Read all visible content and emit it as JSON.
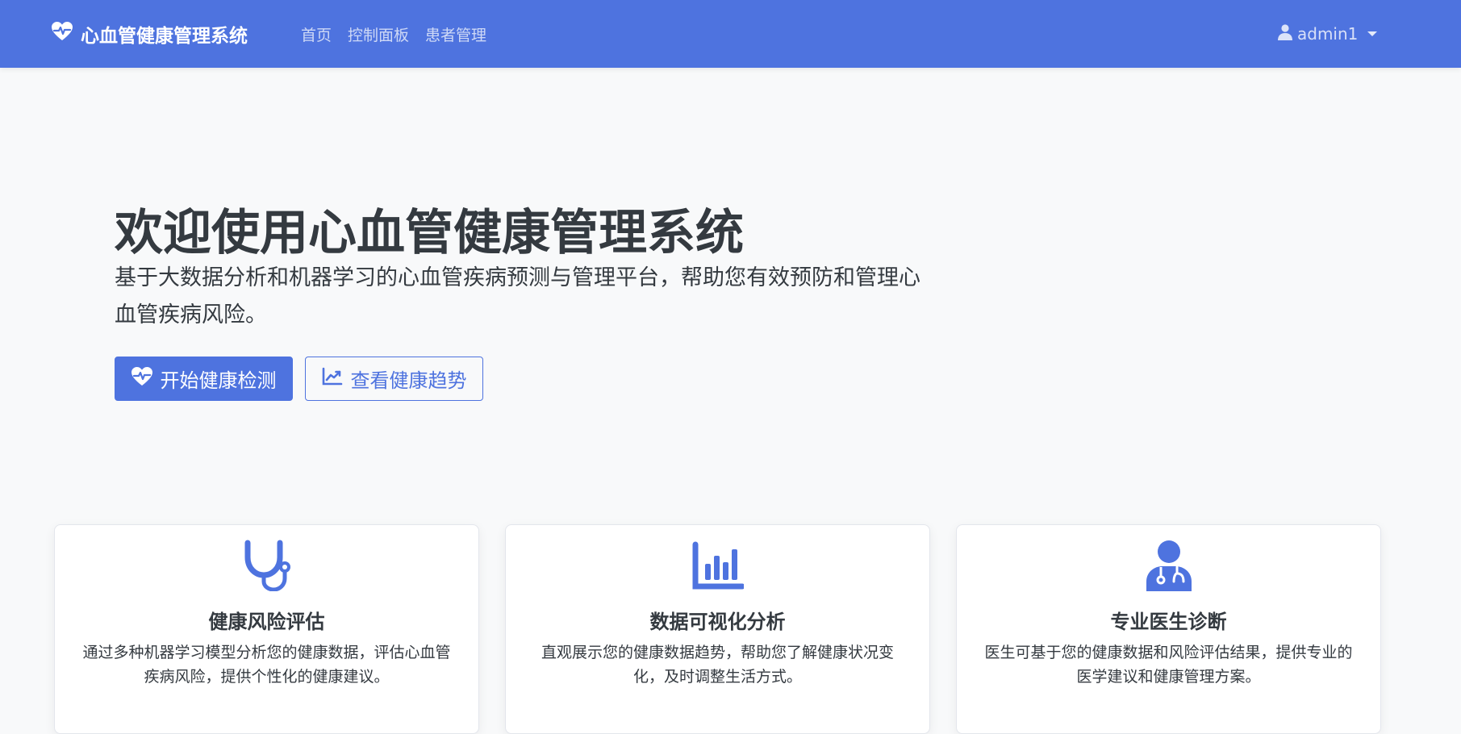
{
  "navbar": {
    "brand": "心血管健康管理系统",
    "brand_icon": "heart-pulse-icon",
    "links": [
      "首页",
      "控制面板",
      "患者管理"
    ],
    "user": "admin1"
  },
  "hero": {
    "title": "欢迎使用心血管健康管理系统",
    "subtitle": "基于大数据分析和机器学习的心血管疾病预测与管理平台，帮助您有效预防和管理心血管疾病风险。",
    "primary_button": "开始健康检测",
    "secondary_button": "查看健康趋势"
  },
  "features": [
    {
      "icon": "stethoscope-icon",
      "title": "健康风险评估",
      "desc": "通过多种机器学习模型分析您的健康数据，评估心血管疾病风险，提供个性化的健康建议。"
    },
    {
      "icon": "bar-chart-icon",
      "title": "数据可视化分析",
      "desc": "直观展示您的健康数据趋势，帮助您了解健康状况变化，及时调整生活方式。"
    },
    {
      "icon": "doctor-icon",
      "title": "专业医生诊断",
      "desc": "医生可基于您的健康数据和风险评估结果，提供专业的医学建议和健康管理方案。"
    }
  ],
  "colors": {
    "primary": "#4e73df",
    "text": "#343a40",
    "background": "#f8f9fa"
  }
}
